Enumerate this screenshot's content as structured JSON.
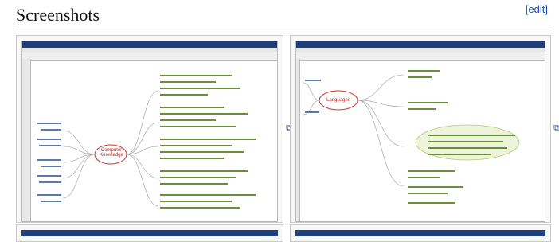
{
  "section": {
    "title": "Screenshots",
    "edit_label": "[edit]"
  },
  "shots": [
    {
      "central_node": "Computer Knowledge"
    },
    {
      "central_node": "Languages"
    }
  ]
}
